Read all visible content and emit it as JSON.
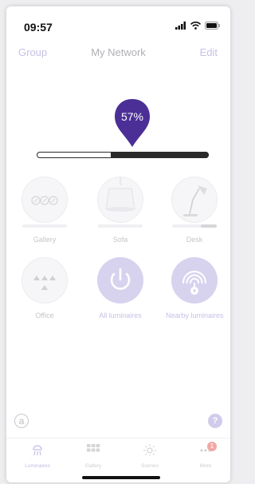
{
  "status": {
    "time": "09:57"
  },
  "nav": {
    "left": "Group",
    "title": "My Network",
    "right": "Edit"
  },
  "brightness": {
    "label": "57%",
    "level": 0.57
  },
  "tiles": [
    {
      "label": "Gallery",
      "icon": "gallery-lamps-icon",
      "brightness": 0
    },
    {
      "label": "Sofa",
      "icon": "pendant-lamp-icon",
      "brightness": 0
    },
    {
      "label": "Desk",
      "icon": "desk-lamp-icon",
      "brightness": 0.35
    },
    {
      "label": "Office",
      "icon": "office-lamps-icon"
    },
    {
      "label": "All luminaires",
      "icon": "power-icon"
    },
    {
      "label": "Nearby luminaires",
      "icon": "nearby-signal-icon"
    }
  ],
  "corner": {
    "left": "a",
    "right": "?"
  },
  "tabs": [
    {
      "label": "Luminaires",
      "icon": "luminaire-icon",
      "active": true
    },
    {
      "label": "Gallery",
      "icon": "grid-icon"
    },
    {
      "label": "Scenes",
      "icon": "sun-icon"
    },
    {
      "label": "More",
      "icon": "more-icon",
      "badge": "1"
    }
  ],
  "colors": {
    "accent": "#4b2f96",
    "accent_light": "#d7d2ee",
    "slider": "#2a2a2a"
  }
}
